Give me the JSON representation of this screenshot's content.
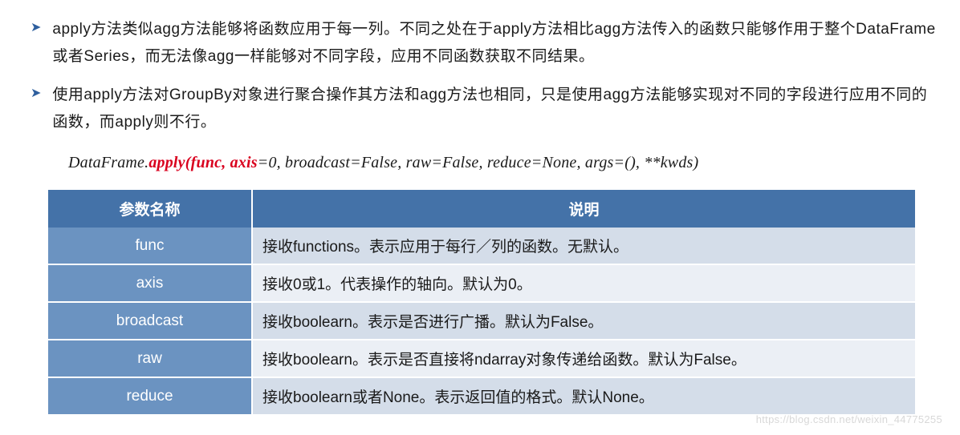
{
  "bullets": [
    "apply方法类似agg方法能够将函数应用于每一列。不同之处在于apply方法相比agg方法传入的函数只能够作用于整个DataFrame或者Series，而无法像agg一样能够对不同字段，应用不同函数获取不同结果。",
    "使用apply方法对GroupBy对象进行聚合操作其方法和agg方法也相同，只是使用agg方法能够实现对不同的字段进行应用不同的函数，而apply则不行。"
  ],
  "code": {
    "prefix": "DataFrame.",
    "method": "apply",
    "paren_open": "(",
    "args_red": "func, axis",
    "args_rest": "=0, broadcast=False, raw=False, reduce=None, args=(), **kwds)"
  },
  "table": {
    "headers": [
      "参数名称",
      "说明"
    ],
    "rows": [
      {
        "name": "func",
        "desc": "接收functions。表示应用于每行／列的函数。无默认。"
      },
      {
        "name": "axis",
        "desc": "接收0或1。代表操作的轴向。默认为0。"
      },
      {
        "name": "broadcast",
        "desc": "接收boolearn。表示是否进行广播。默认为False。"
      },
      {
        "name": "raw",
        "desc": "接收boolearn。表示是否直接将ndarray对象传递给函数。默认为False。"
      },
      {
        "name": "reduce",
        "desc": "接收boolearn或者None。表示返回值的格式。默认None。"
      }
    ]
  },
  "watermark": "https://blog.csdn.net/weixin_44775255"
}
